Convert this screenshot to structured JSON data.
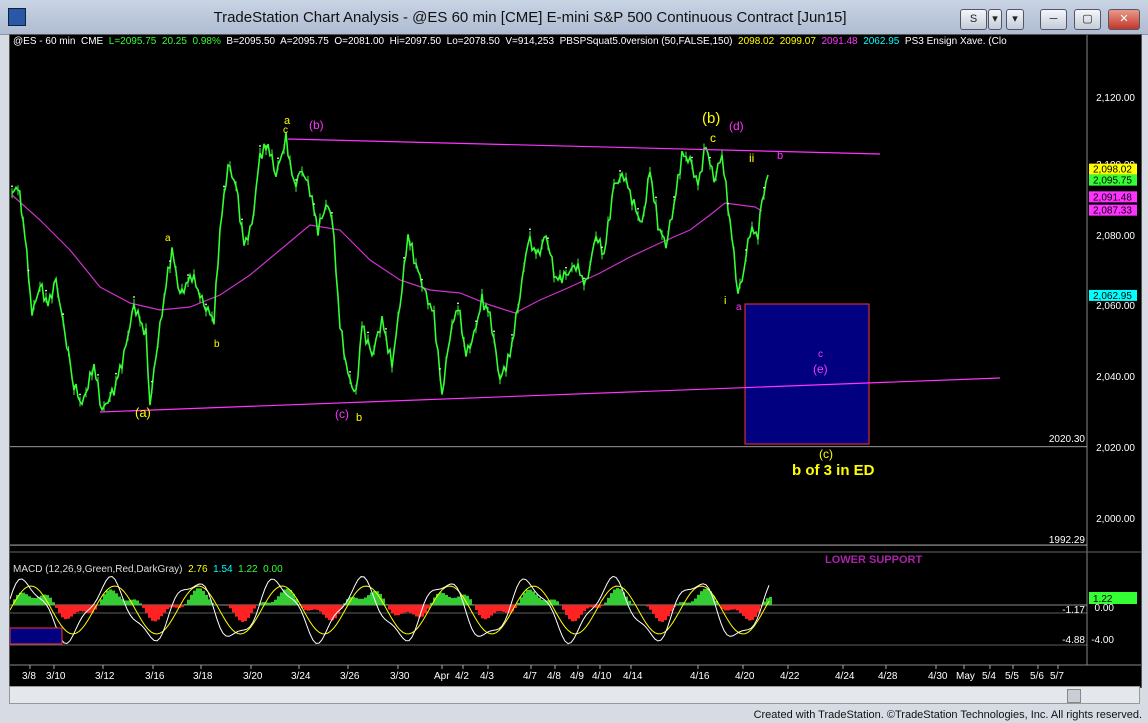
{
  "window": {
    "title": "TradeStation Chart Analysis - @ES 60 min [CME] E-mini S&P 500 Continuous Contract [Jun15]",
    "buttons": [
      "S",
      "▾",
      "▾"
    ]
  },
  "legend": {
    "symbol": "@ES - 60 min",
    "exchange": "CME",
    "last": "L=2095.75",
    "change": "20.25",
    "change_pct": "0.98%",
    "bid": "B=2095.50",
    "ask": "A=2095.75",
    "open": "O=2081.00",
    "high": "Hi=2097.50",
    "low": "Lo=2078.50",
    "volume": "V=914,253",
    "indicator": "PBSPSquat5.0version (50,FALSE,150)",
    "ind_v1": "2098.02",
    "ind_v2": "2099.07",
    "ind_v3": "2091.48",
    "ind_v4": "2062.95",
    "ind2": "PS3 Ensign Xave. (Clo"
  },
  "macd_legend": {
    "name": "MACD (12,26,9,Green,Red,DarkGray)",
    "v1": "2.76",
    "v2": "1.54",
    "v3": "1.22",
    "v4": "0.00"
  },
  "price_axis": {
    "ticks": [
      "2,120.00",
      "2,100.00",
      "2,080.00",
      "2,060.00",
      "2,040.00",
      "2,020.00",
      "2,000.00"
    ],
    "boxes": [
      {
        "label": "2,098.02",
        "color": "#ffff00",
        "price": 2099.3
      },
      {
        "label": "2,095.75",
        "color": "#33ff33",
        "price": 2096.2
      },
      {
        "label": "2,091.48",
        "color": "#ff33ff",
        "price": 2091.4
      },
      {
        "label": "2,087.33",
        "color": "#ff33ff",
        "price": 2087.6
      },
      {
        "label": "2,062.95",
        "color": "#00ffff",
        "price": 2063.3
      }
    ]
  },
  "hlines": [
    {
      "label": "2020.30",
      "price": 2020.3
    },
    {
      "label": "1992.29",
      "price": 1992.29
    }
  ],
  "macd_axis": {
    "current": "1.22",
    "ticks": [
      "-1.17",
      "0.00",
      "-4.00",
      "-4.88"
    ]
  },
  "annotations": {
    "a_top": "a",
    "c_top": "c",
    "b_paren_1": "(b)",
    "b_paren_2": "(b)",
    "c_mid": "c",
    "d_paren": "(d)",
    "ii": "ii",
    "b_line": "b",
    "a_small": "a",
    "b_small_1": "b",
    "a_paren": "(a)",
    "c_paren_1": "(c)",
    "b_small_2": "b",
    "i": "i",
    "a_i": "a",
    "c_box": "c",
    "e_paren": "(e)",
    "c_paren_2": "(c)",
    "b_of_3": "b of 3 in ED",
    "lower_support": "LOWER SUPPORT"
  },
  "x_axis": [
    "3/8",
    "3/10",
    "3/12",
    "3/16",
    "3/18",
    "3/20",
    "3/24",
    "3/26",
    "3/30",
    "Apr",
    "4/2",
    "4/3",
    "4/7",
    "4/8",
    "4/9",
    "4/10",
    "4/14",
    "4/16",
    "4/20",
    "4/22",
    "4/24",
    "4/28",
    "4/30",
    "May",
    "5/4",
    "5/5",
    "5/6",
    "5/7"
  ],
  "colors": {
    "price": "#33ff33",
    "ma": "#cc33cc",
    "trendline": "#ff33ff",
    "annotation_yellow": "#ffff00",
    "annotation_magenta": "#ff33ff",
    "box_fill": "#000080",
    "box_border": "#ff3333",
    "macd_line": "#ffffff",
    "signal_line": "#ffff00",
    "hist_up": "#33cc33",
    "hist_down": "#ff2222"
  },
  "footer": {
    "credit": "Created with TradeStation. ©TradeStation Technologies, Inc. All rights reserved."
  }
}
